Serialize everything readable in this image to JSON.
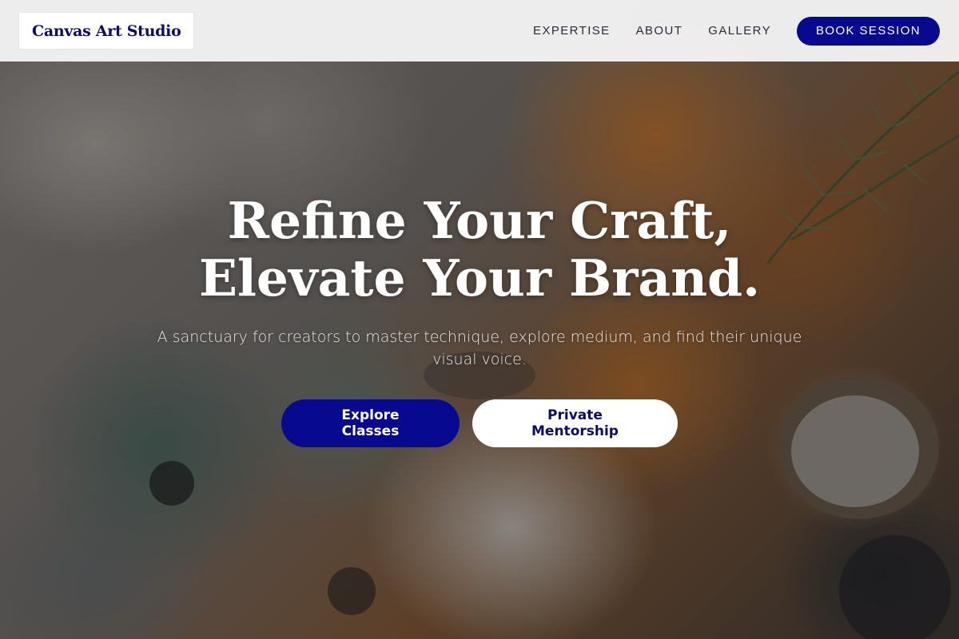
{
  "header": {
    "logo": "Canvas Art Studio",
    "nav": [
      {
        "label": "EXPERTISE"
      },
      {
        "label": "ABOUT"
      },
      {
        "label": "GALLERY"
      }
    ],
    "cta": "BOOK SESSION"
  },
  "hero": {
    "title": "Refine Your Craft, Elevate Your Brand.",
    "subtitle": "A sanctuary for creators to master technique, explore medium, and find their unique visual voice.",
    "primary_button": "Explore Classes",
    "secondary_button": "Private Mentorship"
  },
  "colors": {
    "brand": "#070a8e",
    "header_bg": "#f6f6f8",
    "white": "#ffffff"
  }
}
